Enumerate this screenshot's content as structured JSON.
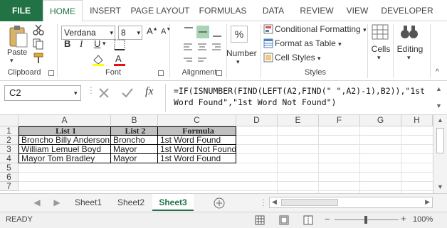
{
  "colors": {
    "accent": "#217346",
    "header_fill": "#bfbfbf"
  },
  "tabs": [
    "FILE",
    "HOME",
    "INSERT",
    "PAGE LAYOUT",
    "FORMULAS",
    "DATA",
    "REVIEW",
    "VIEW",
    "DEVELOPER"
  ],
  "active_tab": "HOME",
  "ribbon": {
    "clipboard": {
      "label": "Clipboard",
      "paste": "Paste"
    },
    "font": {
      "label": "Font",
      "name": "Verdana",
      "size": "8"
    },
    "alignment": {
      "label": "Alignment"
    },
    "number": {
      "label": "Number",
      "percent": "%"
    },
    "styles": {
      "label": "Styles",
      "conditional": "Conditional Formatting",
      "format_table": "Format as Table",
      "cell_styles": "Cell Styles"
    },
    "cells": {
      "label": "Cells"
    },
    "editing": {
      "label": "Editing"
    }
  },
  "formula_bar": {
    "name_box": "C2",
    "fx": "fx",
    "formula": "=IF(ISNUMBER(FIND(LEFT(A2,FIND(\" \",A2)-1),B2)),\"1st\nWord Found\",\"1st Word Not Found\")"
  },
  "grid": {
    "columns": [
      "A",
      "B",
      "C",
      "D",
      "E",
      "F",
      "G",
      "H"
    ],
    "rows": [
      "1",
      "2",
      "3",
      "4",
      "5",
      "6",
      "7"
    ],
    "header": [
      "List 1",
      "List 2",
      "Formula"
    ],
    "data": [
      [
        "Broncho Billy Anderson",
        "Broncho",
        "1st Word Found"
      ],
      [
        "William Lemuel Boyd",
        "Mayor",
        "1st Word Not Found"
      ],
      [
        "Mayor Tom Bradley",
        "Mayor",
        "1st Word Found"
      ]
    ]
  },
  "sheets": [
    "Sheet1",
    "Sheet2",
    "Sheet3"
  ],
  "active_sheet": "Sheet3",
  "status": {
    "ready": "READY",
    "zoom": "100%"
  }
}
